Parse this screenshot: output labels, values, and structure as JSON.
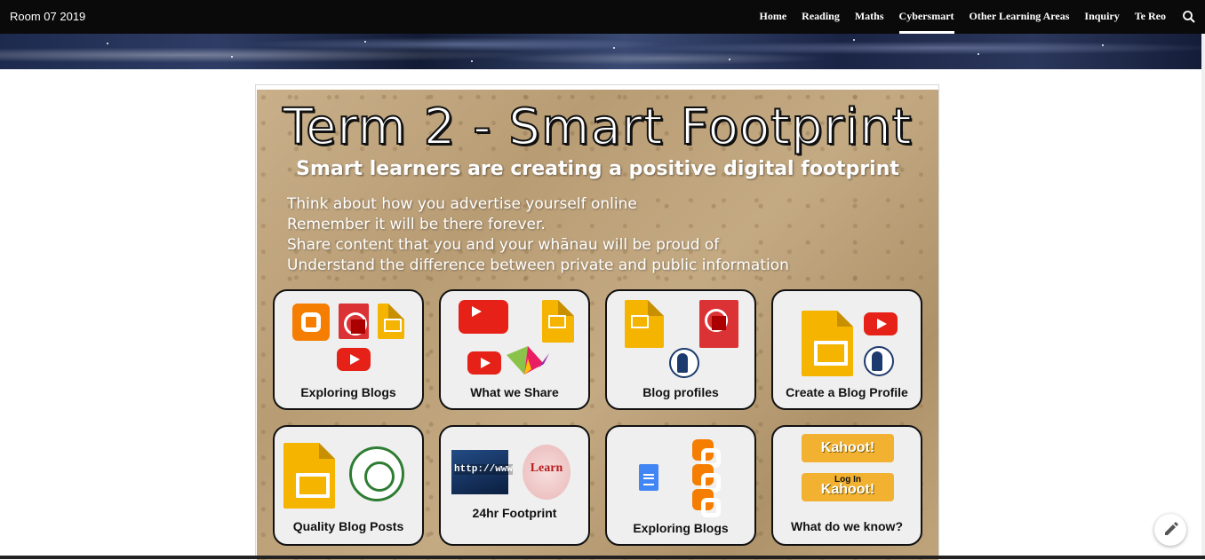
{
  "site": {
    "title": "Room 07 2019"
  },
  "nav": {
    "items": [
      {
        "label": "Home"
      },
      {
        "label": "Reading"
      },
      {
        "label": "Maths"
      },
      {
        "label": "Cybersmart",
        "active": true
      },
      {
        "label": "Other Learning Areas"
      },
      {
        "label": "Inquiry"
      },
      {
        "label": "Te Reo"
      }
    ],
    "search_icon": "search-icon"
  },
  "slide": {
    "title": "Term 2 - Smart Footprint",
    "subtitle": "Smart learners are creating a positive digital footprint",
    "bullets": [
      "Think about how you advertise yourself online",
      "Remember it will be there forever.",
      "Share content that you and your whānau will be proud of",
      "Understand the difference between private and public information"
    ],
    "cards": [
      {
        "label": "Exploring Blogs"
      },
      {
        "label": "What we Share"
      },
      {
        "label": "Blog profiles"
      },
      {
        "label": "Create a Blog Profile"
      },
      {
        "label": "Quality Blog Posts"
      },
      {
        "label": "24hr Footprint"
      },
      {
        "label": "Exploring Blogs"
      },
      {
        "label": "What do we know?"
      }
    ],
    "kahoot": {
      "logo_text": "Kahoot!",
      "login_text": "Log In"
    },
    "url_image_text": "http://www",
    "wordcloud_text": "Learn"
  },
  "colors": {
    "topbar": "#0a0a0a",
    "card_bg": "#efefef",
    "accent_youtube": "#e62117",
    "accent_blogger": "#f57d00",
    "accent_slides": "#f4b400",
    "accent_kahoot": "#f2b130"
  },
  "edit_button_icon": "pencil-icon"
}
